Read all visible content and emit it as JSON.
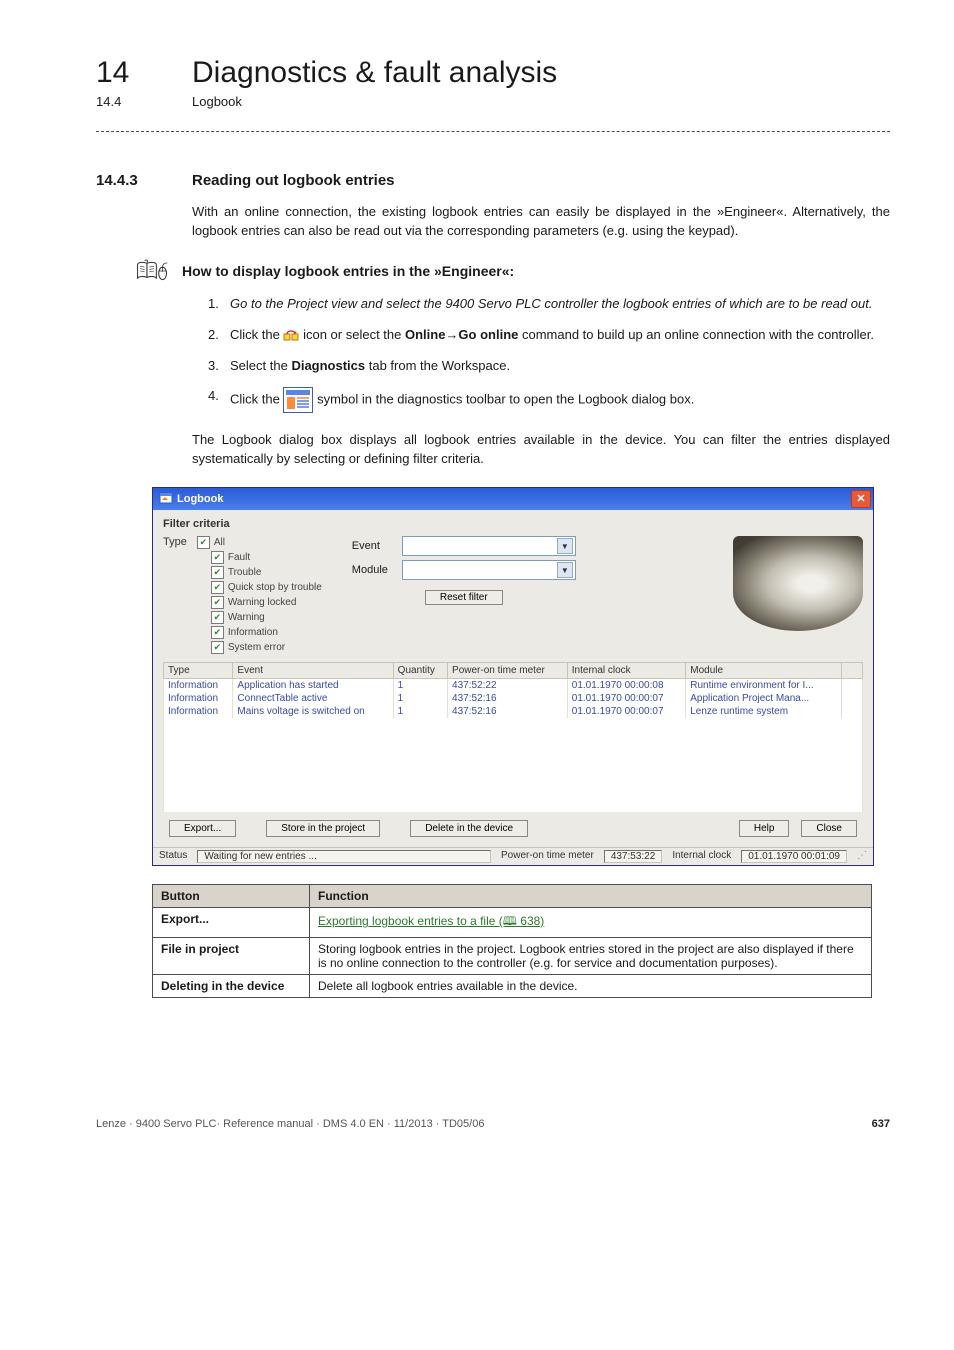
{
  "header": {
    "chapter_num": "14",
    "chapter_title": "Diagnostics & fault analysis",
    "sub_num": "14.4",
    "sub_title": "Logbook"
  },
  "section": {
    "num": "14.4.3",
    "title": "Reading out logbook entries",
    "intro": "With an online connection, the existing logbook entries can easily be displayed in the »Engineer«. Alternatively, the logbook entries can also be read out via the corresponding parameters (e.g. using the keypad).",
    "howto_title": "How to display logbook entries in the »Engineer«:",
    "steps": {
      "s1": "Go to the Project view and select the 9400 Servo PLC controller the logbook entries of which are to be read out.",
      "s2_pre": "Click the ",
      "s2_mid": " icon or select the ",
      "s2_cmd": "Online→Go online",
      "s2_post": " command to build up an online connection with the controller.",
      "s3_pre": "Select the ",
      "s3_bold": "Diagnostics",
      "s3_post": " tab from the Workspace.",
      "s4_pre": "Click the ",
      "s4_mid": " symbol in the diagnostics toolbar to open the Logbook dialog box."
    },
    "after_steps": "The Logbook dialog box displays all logbook entries available in the device. You can filter the entries displayed systematically by selecting or defining filter criteria."
  },
  "dialog": {
    "title": "Logbook",
    "filter_label": "Filter criteria",
    "type_label": "Type",
    "checks": {
      "all": "All",
      "fault": "Fault",
      "trouble": "Trouble",
      "quickstop": "Quick stop by trouble",
      "warnlock": "Warning locked",
      "warning": "Warning",
      "info": "Information",
      "syserr": "System error"
    },
    "event_label": "Event",
    "module_label": "Module",
    "reset_btn": "Reset filter",
    "columns": {
      "c1": "Type",
      "c2": "Event",
      "c3": "Quantity",
      "c4": "Power-on time meter",
      "c5": "Internal clock",
      "c6": "Module"
    },
    "rows": [
      {
        "type": "Information",
        "event": "Application has started",
        "qty": "1",
        "pot": "437:52:22",
        "clock": "01.01.1970 00:00:08",
        "module": "Runtime environment for I..."
      },
      {
        "type": "Information",
        "event": "ConnectTable active",
        "qty": "1",
        "pot": "437:52:16",
        "clock": "01.01.1970 00:00:07",
        "module": "Application Project Mana..."
      },
      {
        "type": "Information",
        "event": "Mains voltage is switched on",
        "qty": "1",
        "pot": "437:52:16",
        "clock": "01.01.1970 00:00:07",
        "module": "Lenze runtime system"
      }
    ],
    "btn_export": "Export...",
    "btn_store": "Store in the project",
    "btn_delete": "Delete in the device",
    "btn_help": "Help",
    "btn_close": "Close",
    "status_label": "Status",
    "status_text": "Waiting for new entries ...",
    "status_pot_label": "Power-on time meter",
    "status_pot": "437:53:22",
    "status_clock_label": "Internal clock",
    "status_clock": "01.01.1970 00:01:09"
  },
  "doc_table": {
    "h1": "Button",
    "h2": "Function",
    "r1c1": "Export...",
    "r1c2_link": "Exporting logbook entries to a file",
    "r1c2_ref": " (🕮 638)",
    "r2c1": "File in project",
    "r2c2": "Storing logbook entries in the project. Logbook entries stored in the project are also displayed if there is no online connection to the controller (e.g. for service and documentation purposes).",
    "r3c1": "Deleting in the device",
    "r3c2": "Delete all logbook entries available in the device."
  },
  "footer": {
    "left": "Lenze · 9400 Servo PLC· Reference manual · DMS 4.0 EN · 11/2013 · TD05/06",
    "right": "637"
  }
}
